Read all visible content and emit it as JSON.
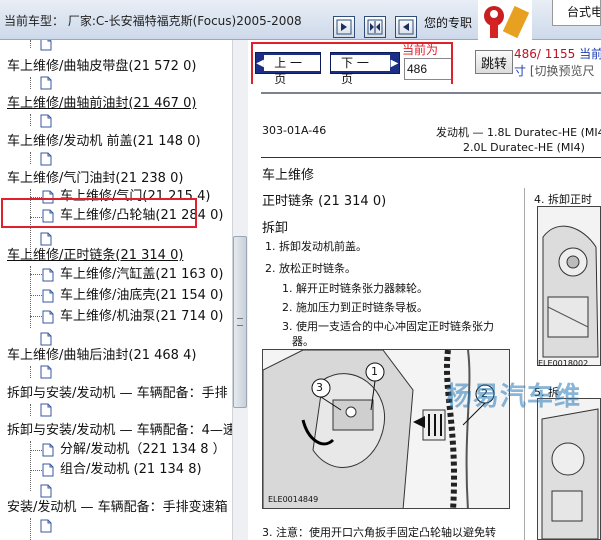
{
  "header": {
    "car_model": "当前车型：   厂家:C-长安福特福克斯(Focus)2005-2008",
    "user_label": "您的专职",
    "right_tab": "台式电"
  },
  "tree": {
    "items": [
      {
        "label": "车上维修/曲轴皮带盘(21 572 0)",
        "underline": false
      },
      {
        "label": "车上维修/曲轴前油封(21 467 0)",
        "underline": true
      },
      {
        "label": "车上维修/发动机 前盖(21 148 0)",
        "underline": false
      },
      {
        "label": "车上维修/气门油封(21 238 0)",
        "underline": false
      },
      {
        "label": "车上维修/气门(21 215 4)",
        "underline": false
      },
      {
        "label": "车上维修/凸轮轴(21 284 0)",
        "underline": false
      },
      {
        "label": "车上维修/正时链条(21 314 0)",
        "underline": true
      },
      {
        "label": "车上维修/汽缸盖(21 163 0)",
        "underline": false
      },
      {
        "label": "车上维修/油底壳(21 154 0)",
        "underline": false
      },
      {
        "label": "车上维修/机油泵(21 714 0)",
        "underline": false
      },
      {
        "label": "车上维修/曲轴后油封(21 468 4)",
        "underline": false
      },
      {
        "label": "拆卸与安装/发动机 — 车辆配备：手排",
        "underline": false
      },
      {
        "label": "拆卸与安装/发动机 — 车辆配备：4—速",
        "underline": false
      },
      {
        "label": "分解/发动机（221 134 8 ）",
        "underline": false
      },
      {
        "label": "组合/发动机 (21 134 8)",
        "underline": false
      },
      {
        "label": "安装/发动机 — 车辆配备：手排变速箱",
        "underline": false
      }
    ]
  },
  "pager": {
    "prev_label": "上 一 页",
    "next_label": "下 一 页",
    "current_label": "当前为",
    "page_value": "486",
    "jump_label": "跳转",
    "page_count_a": "486/",
    "page_count_b": " 1155 ",
    "page_count_c": "当前",
    "page_count_d": "寸",
    "preview_switch": "[切换预览尺"
  },
  "document": {
    "code": "303-01A-46",
    "engine_line1": "发动机 — 1.8L Duratec-HE (MI4)",
    "engine_line2": "2.0L Duratec-HE (MI4)",
    "section": "车上维修",
    "heading": "正时链条 (21 314 0)",
    "removal": "拆卸",
    "step1": "1. 拆卸发动机前盖。",
    "step2": "2. 放松正时链条。",
    "sub1": "1. 解开正时链条张力器棘轮。",
    "sub2": "2. 施加压力到正时链条导板。",
    "sub3": "3. 使用一支适合的中心冲固定正时链条张力",
    "sub3b": "器。",
    "step3": "3. 注意：使用开口六角扳手固定凸轮轴以避免转",
    "right_step4": "4. 拆卸正时",
    "right_step5": "5. 拆",
    "fig_left_id": "ELE0014849",
    "fig_right_id": "ELE0018002",
    "callout_1": "1",
    "callout_2": "2",
    "callout_3": "3",
    "watermark": "杨易汽车维"
  }
}
